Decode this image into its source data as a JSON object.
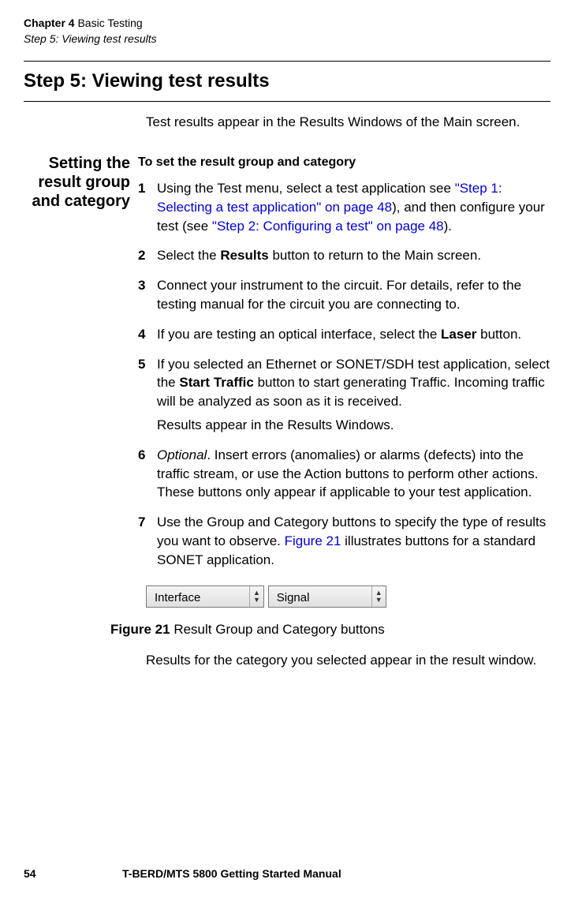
{
  "header": {
    "chapter_label": "Chapter 4",
    "chapter_title": "Basic Testing",
    "step_line": "Step 5: Viewing test results"
  },
  "section_title": "Step 5: Viewing test results",
  "intro": "Test results appear in the Results Windows of the Main screen.",
  "sidebar_heading": "Setting the result group and category",
  "subhead": "To set the result group and category",
  "steps": {
    "s1": {
      "num": "1",
      "t1": "Using the Test menu, select a test application see ",
      "link1": "\"Step 1: Selecting a test application\" on page 48",
      "t2": "), and then configure your test (see ",
      "link2": "\"Step 2: Configuring a test\" on page 48",
      "t3": ")."
    },
    "s2": {
      "num": "2",
      "t1": "Select the ",
      "bold1": "Results",
      "t2": " button to return to the Main screen."
    },
    "s3": {
      "num": "3",
      "t1": "Connect your instrument to the circuit. For details, refer to the testing manual for the circuit you are connecting to."
    },
    "s4": {
      "num": "4",
      "t1": "If you are testing an optical interface, select the ",
      "bold1": "Laser",
      "t2": " button."
    },
    "s5": {
      "num": "5",
      "t1": "If you selected an Ethernet or SONET/SDH test application, select the ",
      "bold1": "Start Traffic",
      "t2": " button to start generating Traffic. Incoming traffic will be analyzed as soon as it is received.",
      "follow": "Results appear in the Results Windows."
    },
    "s6": {
      "num": "6",
      "italic1": "Optional",
      "t1": ". Insert errors (anomalies) or alarms (defects) into the traffic stream, or use the Action buttons to perform other actions. These buttons only appear if applicable to your test application."
    },
    "s7": {
      "num": "7",
      "t1": "Use the Group and Category buttons to specify the type of results you want to observe. ",
      "link1": "Figure 21",
      "t2": " illustrates buttons for a standard SONET application."
    }
  },
  "dropdowns": {
    "interface": "Interface",
    "signal": "Signal"
  },
  "figure": {
    "label": "Figure 21",
    "caption": "Result Group and Category buttons"
  },
  "post_figure": "Results for the category you selected appear in the result window.",
  "footer": {
    "page": "54",
    "manual": "T-BERD/MTS 5800 Getting Started Manual"
  }
}
